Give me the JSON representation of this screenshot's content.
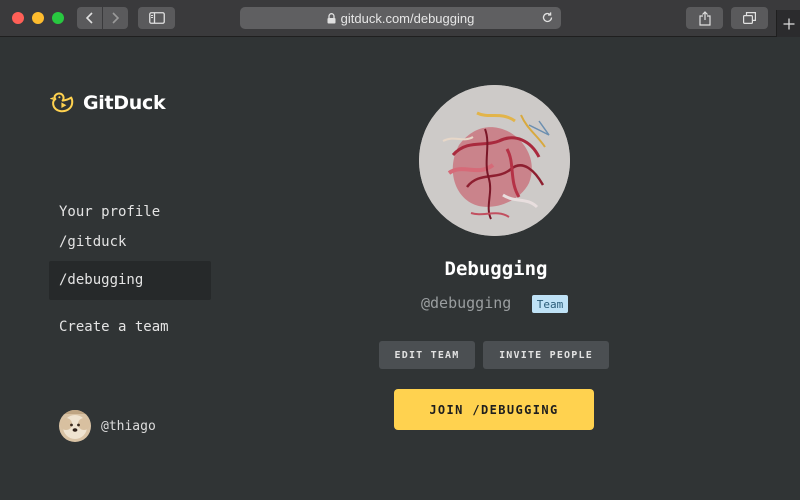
{
  "browser": {
    "url": "gitduck.com/debugging",
    "icons": {
      "back": "chevron-left-icon",
      "forward": "chevron-right-icon",
      "sidebar": "sidebar-icon",
      "lock": "lock-icon",
      "reload": "reload-icon",
      "share": "share-icon",
      "tabs": "tabs-overview-icon",
      "new_tab": "plus-icon"
    }
  },
  "brand": {
    "name": "GitDuck",
    "accent": "#ffd24f"
  },
  "sidebar": {
    "items": [
      {
        "label": "Your profile",
        "active": false
      },
      {
        "label": "/gitduck",
        "active": false
      },
      {
        "label": "/debugging",
        "active": true
      },
      {
        "label": "Create a team",
        "active": false
      }
    ],
    "user": {
      "handle": "@thiago"
    }
  },
  "team": {
    "name": "Debugging",
    "handle": "@debugging",
    "badge": "Team",
    "badge_color": "#bfe2f6",
    "actions": {
      "edit": "EDIT TEAM",
      "invite": "INVITE PEOPLE",
      "join": "JOIN /DEBUGGING"
    }
  }
}
